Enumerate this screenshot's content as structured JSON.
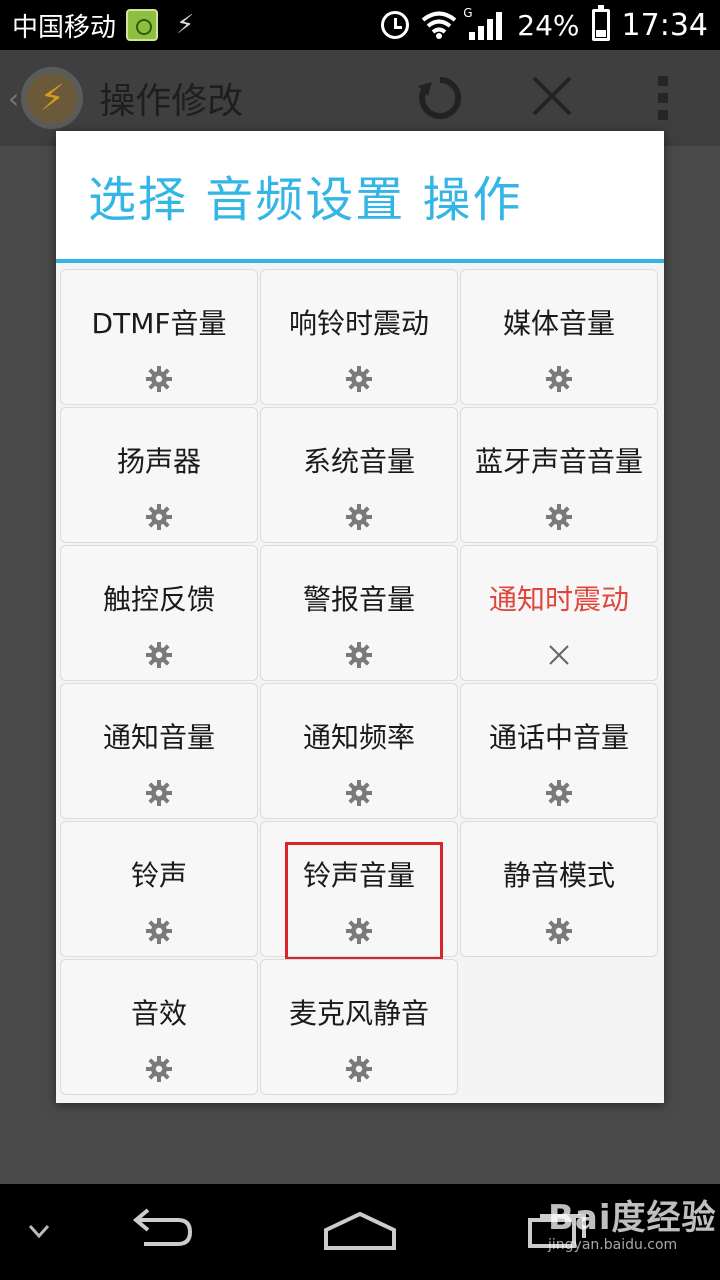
{
  "status_bar": {
    "carrier": "中国移动",
    "battery_percent": "24%",
    "time": "17:34",
    "network_type": "G",
    "icons": [
      "sim-manager-icon",
      "lightning-icon",
      "alarm-icon",
      "wifi-icon",
      "signal-icon",
      "battery-icon"
    ]
  },
  "app_bar": {
    "back_glyph": "‹",
    "logo_glyph": "⚡",
    "title": "操作修改",
    "icons": [
      "refresh-icon",
      "close-icon",
      "overflow-menu-icon"
    ]
  },
  "dialog": {
    "title": "选择 音频设置 操作",
    "accent_color": "#33b5e5",
    "highlight_color": "#d8262a",
    "items": [
      {
        "label": "DTMF音量",
        "icon": "gear-icon",
        "enabled": true
      },
      {
        "label": "响铃时震动",
        "icon": "gear-icon",
        "enabled": true
      },
      {
        "label": "媒体音量",
        "icon": "gear-icon",
        "enabled": true
      },
      {
        "label": "扬声器",
        "icon": "gear-icon",
        "enabled": true
      },
      {
        "label": "系统音量",
        "icon": "gear-icon",
        "enabled": true
      },
      {
        "label": "蓝牙声音音量",
        "icon": "gear-icon",
        "enabled": true
      },
      {
        "label": "触控反馈",
        "icon": "gear-icon",
        "enabled": true
      },
      {
        "label": "警报音量",
        "icon": "gear-icon",
        "enabled": true
      },
      {
        "label": "通知时震动",
        "icon": "close-icon",
        "enabled": false
      },
      {
        "label": "通知音量",
        "icon": "gear-icon",
        "enabled": true
      },
      {
        "label": "通知频率",
        "icon": "gear-icon",
        "enabled": true
      },
      {
        "label": "通话中音量",
        "icon": "gear-icon",
        "enabled": true
      },
      {
        "label": "铃声",
        "icon": "gear-icon",
        "enabled": true
      },
      {
        "label": "铃声音量",
        "icon": "gear-icon",
        "enabled": true,
        "highlighted": true
      },
      {
        "label": "静音模式",
        "icon": "gear-icon",
        "enabled": true
      },
      {
        "label": "音效",
        "icon": "gear-icon",
        "enabled": true
      },
      {
        "label": "麦克风静音",
        "icon": "gear-icon",
        "enabled": true
      }
    ]
  },
  "nav_bar": {
    "icons": [
      "collapse-chevron-icon",
      "back-icon",
      "home-icon",
      "recent-apps-icon"
    ]
  },
  "watermark": {
    "logo": "Bai度经验",
    "url": "jingyan.baidu.com"
  }
}
